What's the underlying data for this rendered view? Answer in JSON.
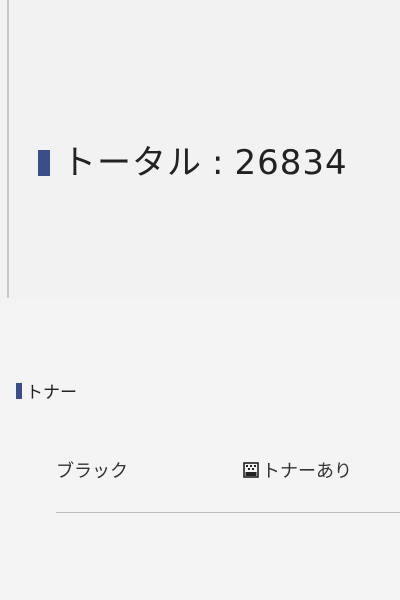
{
  "total": {
    "label": "トータル",
    "separator": ":",
    "value": "26834"
  },
  "toner_section": {
    "title": "トナー",
    "rows": [
      {
        "name": "ブラック",
        "status": "トナーあり",
        "icon": "toner-cartridge-icon"
      }
    ]
  },
  "colors": {
    "accent": "#3a4f8a",
    "divider": "#bdbdbd"
  }
}
